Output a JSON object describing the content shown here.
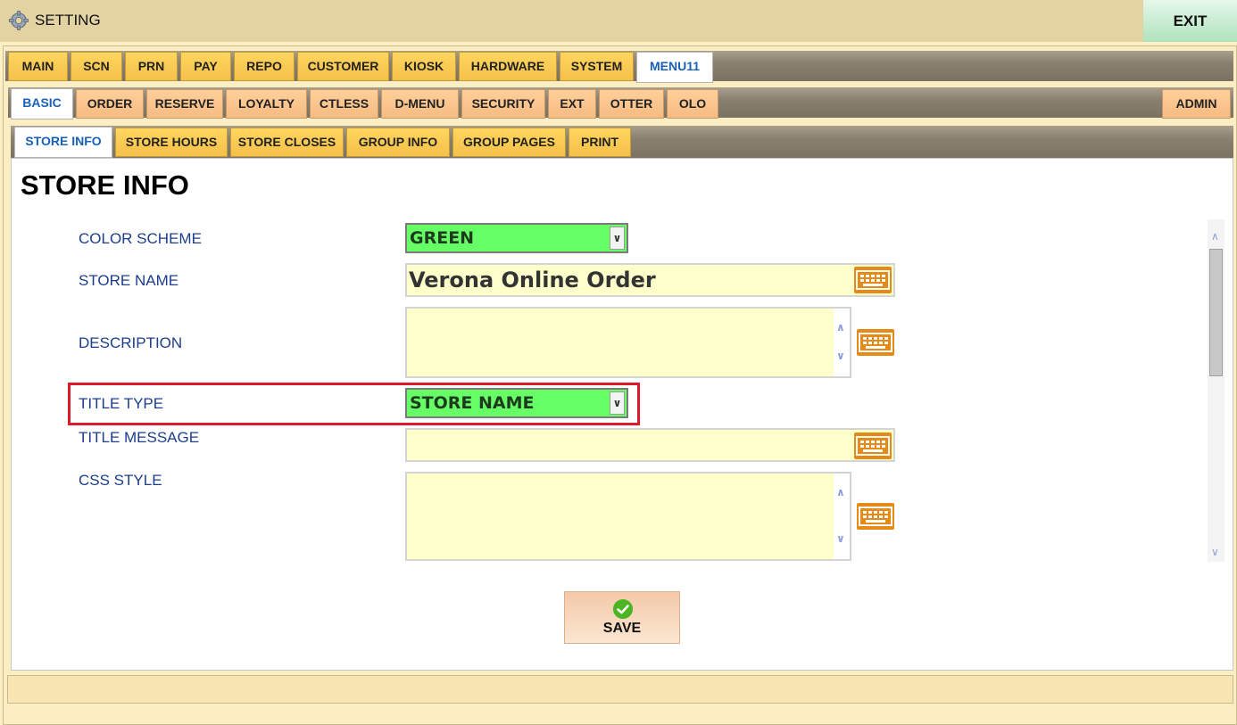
{
  "app": {
    "title": "SETTING",
    "exit_label": "EXIT"
  },
  "main_tabs": [
    "MAIN",
    "SCN",
    "PRN",
    "PAY",
    "REPO",
    "CUSTOMER",
    "KIOSK",
    "HARDWARE",
    "SYSTEM",
    "MENU11"
  ],
  "main_tab_active": "MENU11",
  "sub_tabs": [
    "BASIC",
    "ORDER",
    "RESERVE",
    "LOYALTY",
    "CTLESS",
    "D-MENU",
    "SECURITY",
    "EXT",
    "OTTER",
    "OLO"
  ],
  "sub_tab_active": "BASIC",
  "admin_tab": "ADMIN",
  "section_tabs": [
    "STORE INFO",
    "STORE HOURS",
    "STORE CLOSES",
    "GROUP INFO",
    "GROUP PAGES",
    "PRINT"
  ],
  "section_tab_active": "STORE INFO",
  "page": {
    "title": "STORE INFO",
    "fields": {
      "color_scheme": {
        "label": "COLOR SCHEME",
        "value": "GREEN"
      },
      "store_name": {
        "label": "STORE NAME",
        "value": "Verona Online Order"
      },
      "description": {
        "label": "DESCRIPTION",
        "value": ""
      },
      "title_type": {
        "label": "TITLE TYPE",
        "value": "STORE NAME"
      },
      "title_message": {
        "label": "TITLE MESSAGE",
        "value": ""
      },
      "css_style": {
        "label": "CSS STYLE",
        "value": ""
      }
    },
    "save_label": "SAVE"
  },
  "colors": {
    "select_bg": "#66ff66",
    "input_bg": "#ffffcc",
    "keyboard_icon": "#e58a17",
    "highlight_box": "#e0182c",
    "tab_gold": "#ffd65e",
    "tab_peach": "#ffcf9a",
    "active_tab_text": "#1960b8",
    "label_text": "#1c3e8c"
  },
  "icons": [
    "gear-icon",
    "keyboard-icon",
    "checkmark-icon",
    "chevron-down-icon",
    "scroll-up-icon",
    "scroll-down-icon"
  ]
}
